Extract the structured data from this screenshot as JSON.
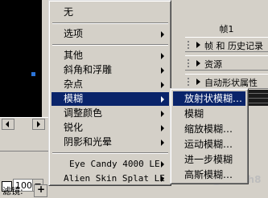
{
  "colors": {
    "highlight": "#0a246a",
    "menu_bg": "#d4d0c8",
    "stage": "#000000"
  },
  "main_menu": {
    "items": [
      {
        "label": "无",
        "submenu": false
      },
      {
        "label": "选项",
        "submenu": true
      },
      {
        "label": "其他",
        "submenu": true
      },
      {
        "label": "斜角和浮雕",
        "submenu": true
      },
      {
        "label": "杂点",
        "submenu": true
      },
      {
        "label": "模糊",
        "submenu": true,
        "highlighted": true
      },
      {
        "label": "调整颜色",
        "submenu": true
      },
      {
        "label": "锐化",
        "submenu": true
      },
      {
        "label": "阴影和光晕",
        "submenu": true
      },
      {
        "label": "Eye Candy 4000 LE",
        "submenu": true
      },
      {
        "label": "Alien Skin Splat LE",
        "submenu": true
      }
    ]
  },
  "blur_submenu": {
    "items": [
      {
        "label": "放射状模糊…",
        "highlighted": true
      },
      {
        "label": "模糊"
      },
      {
        "label": "缩放模糊…"
      },
      {
        "label": "运动模糊…"
      },
      {
        "label": "进一步模糊"
      },
      {
        "label": "高斯模糊…"
      }
    ]
  },
  "right_panel": {
    "frame_header": "帧1",
    "rows": [
      {
        "label": "帧 和 历史记录"
      },
      {
        "label": "资源"
      },
      {
        "label": "自动形状属性"
      }
    ]
  },
  "bottom": {
    "zoom_value": "100",
    "filter_label": "滤镜:"
  },
  "watermark": {
    "text": "Flash8",
    "icon": "swirl-logo-icon"
  }
}
